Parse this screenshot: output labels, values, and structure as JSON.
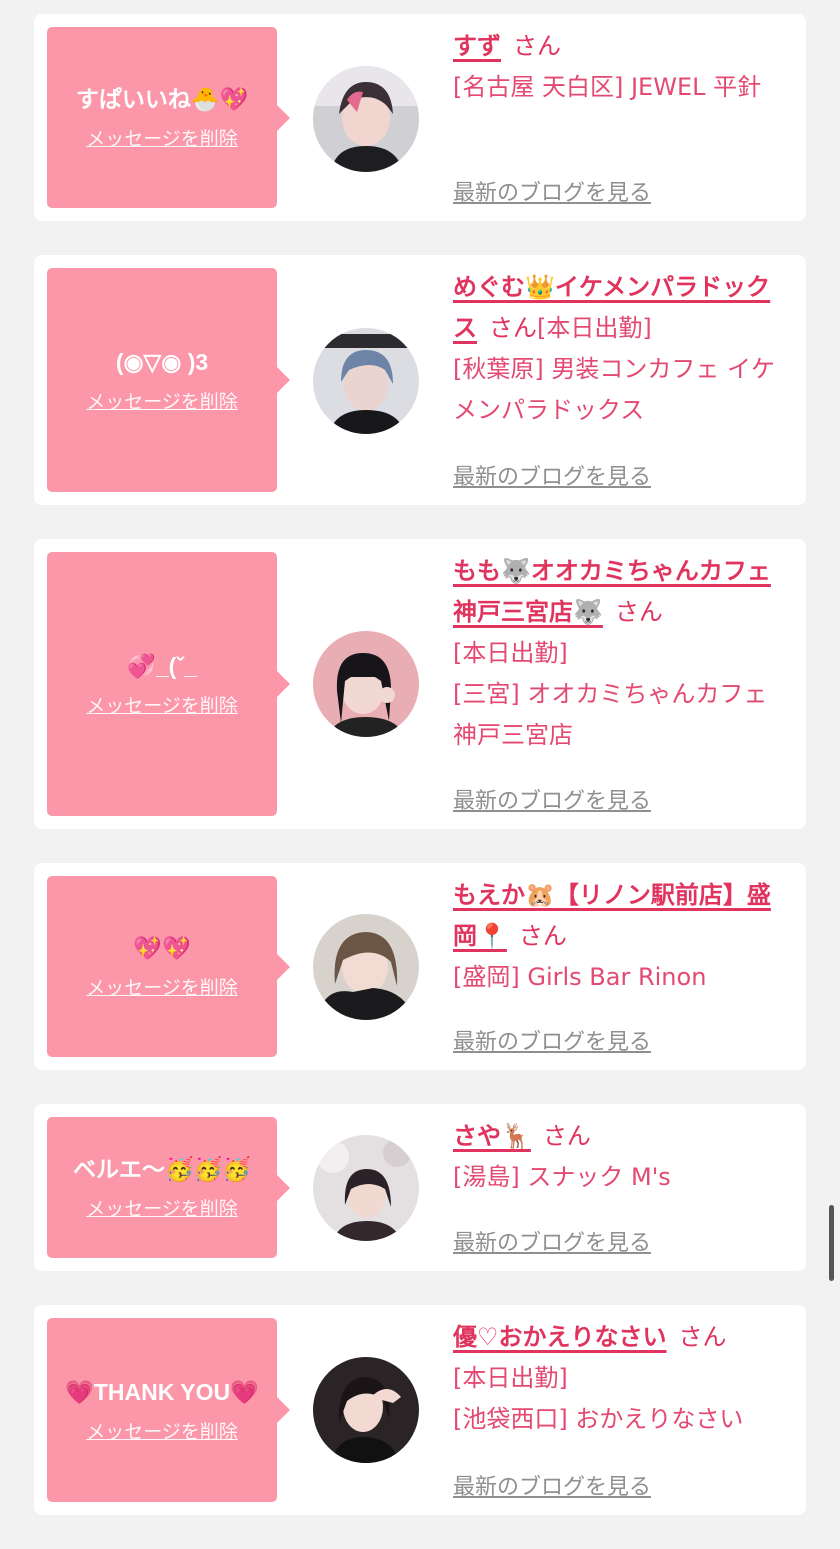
{
  "delete_label": "メッセージを削除",
  "blog_label": "最新のブログを見る",
  "honorific": "さん",
  "colors": {
    "bubble": "#fc97a9",
    "name": "#e0345f",
    "shop": "#e34971",
    "blog": "#8f8f8f",
    "background": "#f2f2f3"
  },
  "items": [
    {
      "message": "すぱいいね🐣💖",
      "name": "すず",
      "tag": "",
      "shop": "[名古屋 天白区] JEWEL 平針",
      "avatar_icon": "user-avatar-photo"
    },
    {
      "message": "(◉▽◉ )3",
      "name": "めぐむ👑イケメンパラドックス",
      "tag": "[本日出勤]",
      "shop": "[秋葉原] 男装コンカフェ イケメンパラドックス",
      "avatar_icon": "user-avatar-photo"
    },
    {
      "message": "💞_(ˇ_",
      "name": "もも🐺オオカミちゃんカフェ神戸三宮店🐺",
      "tag": "[本日出勤]",
      "shop": "[三宮] オオカミちゃんカフェ神戸三宮店",
      "avatar_icon": "user-avatar-photo"
    },
    {
      "message": "💖💖",
      "name": "もえか🐹【リノン駅前店】盛岡📍",
      "tag": "",
      "shop": "[盛岡] Girls Bar Rinon",
      "avatar_icon": "user-avatar-photo"
    },
    {
      "message": "ベルエ〜🥳🥳🥳",
      "name": "さや🦌",
      "tag": "",
      "shop": "[湯島] スナック M's",
      "avatar_icon": "user-avatar-photo"
    },
    {
      "message": "💗THANK YOU💗",
      "name": "優♡おかえりなさい",
      "tag": "[本日出勤]",
      "shop": "[池袋西口] おかえりなさい",
      "avatar_icon": "user-avatar-photo"
    }
  ]
}
